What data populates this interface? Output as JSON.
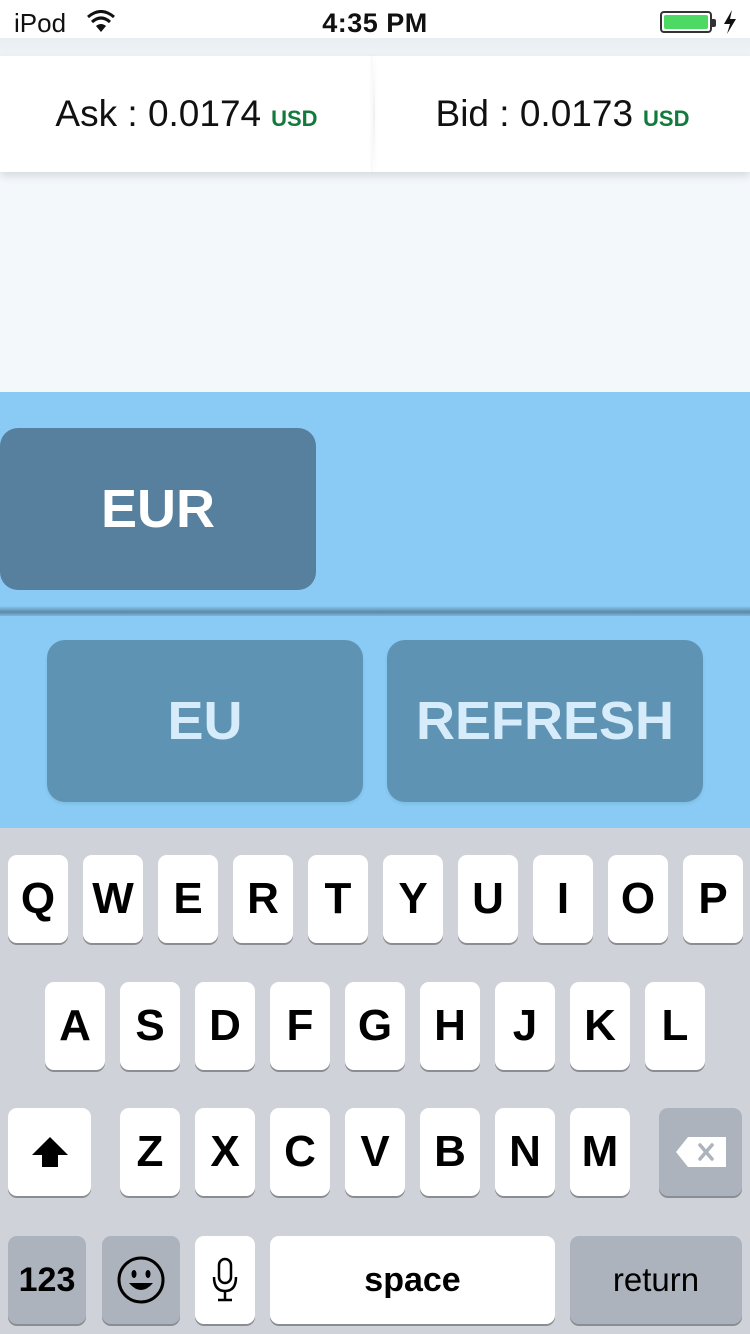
{
  "status_bar": {
    "carrier": "iPod",
    "time": "4:35 PM"
  },
  "quotes": {
    "ask": {
      "label": "Ask : 0.0174",
      "currency": "USD"
    },
    "bid": {
      "label": "Bid : 0.0173",
      "currency": "USD"
    }
  },
  "currency_selector": {
    "label": "EUR"
  },
  "actions": {
    "input_label": "EU",
    "refresh_label": "REFRESH"
  },
  "keyboard": {
    "row1": [
      "Q",
      "W",
      "E",
      "R",
      "T",
      "Y",
      "U",
      "I",
      "O",
      "P"
    ],
    "row2": [
      "A",
      "S",
      "D",
      "F",
      "G",
      "H",
      "J",
      "K",
      "L"
    ],
    "row3": [
      "Z",
      "X",
      "C",
      "V",
      "B",
      "N",
      "M"
    ],
    "numbers_label": "123",
    "space_label": "space",
    "return_label": "return"
  },
  "colors": {
    "accent_blue": "#89cbf5",
    "button_dark": "#56809d",
    "usd_green": "#127a3c"
  }
}
